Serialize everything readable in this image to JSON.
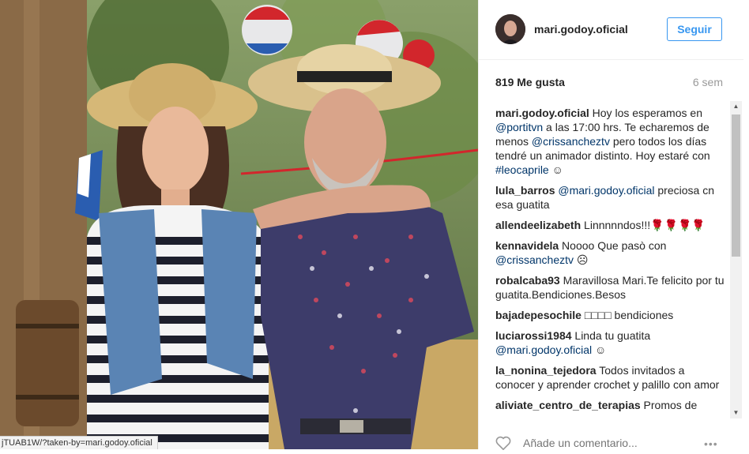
{
  "photo": {
    "description_icon": "photo",
    "status_url": "jTUAB1W/?taken-by=mari.godoy.oficial"
  },
  "post": {
    "username": "mari.godoy.oficial",
    "follow_label": "Seguir",
    "likes": "819 Me gusta",
    "time_ago": "6 sem"
  },
  "comments": [
    {
      "user": "mari.godoy.oficial",
      "text": "Hoy los esperamos en @portitvn a las 17:00 hrs. Te echaremos de menos @crissancheztv pero todos los días tendré un animador distinto. Hoy estaré con #leocaprile ☺"
    },
    {
      "user": "lula_barros",
      "text": "@mari.godoy.oficial preciosa cn esa guatita"
    },
    {
      "user": "allendeelizabeth",
      "text": "Linnnnndos!!!🌹🌹🌹🌹"
    },
    {
      "user": "kennavidela",
      "text": "Noooo Que pasò con @crissancheztv ☹"
    },
    {
      "user": "robalcaba93",
      "text": "Maravillosa Mari.Te felicito por tu guatita.Bendiciones.Besos"
    },
    {
      "user": "bajadepesochile",
      "text": "□□□□ bendiciones"
    },
    {
      "user": "luciarossi1984",
      "text": "Linda tu guatita @mari.godoy.oficial ☺"
    },
    {
      "user": "la_nonina_tejedora",
      "text": "Todos invitados a conocer y aprender crochet y palillo con amor"
    },
    {
      "user": "aliviate_centro_de_terapias",
      "text": "Promos de"
    }
  ],
  "add_comment": {
    "placeholder": "Añade un comentario..."
  },
  "colors": {
    "accent": "#3897f0",
    "link": "#003569",
    "text": "#262626",
    "muted": "#999999"
  }
}
